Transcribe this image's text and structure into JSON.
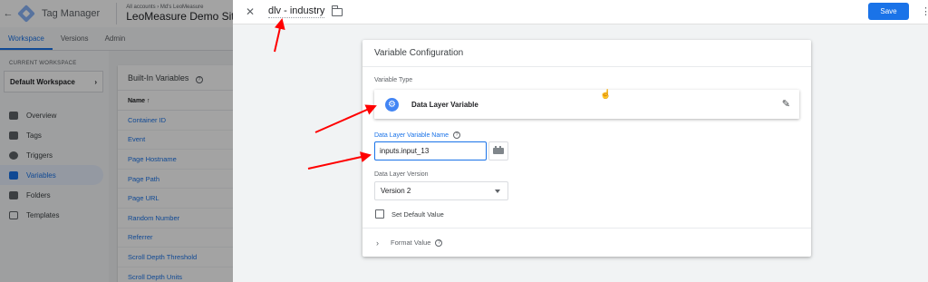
{
  "app": {
    "name": "Tag Manager",
    "account_crumb": "All accounts › Md's LeoMeasure",
    "container_name": "LeoMeasure Demo Site"
  },
  "tabs": [
    "Workspace",
    "Versions",
    "Admin"
  ],
  "workspace": {
    "label": "CURRENT WORKSPACE",
    "name": "Default Workspace"
  },
  "nav": [
    "Overview",
    "Tags",
    "Triggers",
    "Variables",
    "Folders",
    "Templates"
  ],
  "builtins": {
    "title": "Built-In Variables",
    "column_header": "Name ↑",
    "rows": [
      "Container ID",
      "Event",
      "Page Hostname",
      "Page Path",
      "Page URL",
      "Random Number",
      "Referrer",
      "Scroll Depth Threshold",
      "Scroll Depth Units"
    ]
  },
  "sheet": {
    "title": "dlv - industry",
    "save_label": "Save"
  },
  "config": {
    "title": "Variable Configuration",
    "type_label": "Variable Type",
    "type_name": "Data Layer Variable",
    "dlv_name_label": "Data Layer Variable Name",
    "dlv_name_value": "inputs.input_13",
    "version_label": "Data Layer Version",
    "version_value": "Version 2",
    "default_value_label": "Set Default Value",
    "format_value_label": "Format Value"
  },
  "colors": {
    "accent": "#1a73e8",
    "annotation_arrow": "#ff0000"
  }
}
